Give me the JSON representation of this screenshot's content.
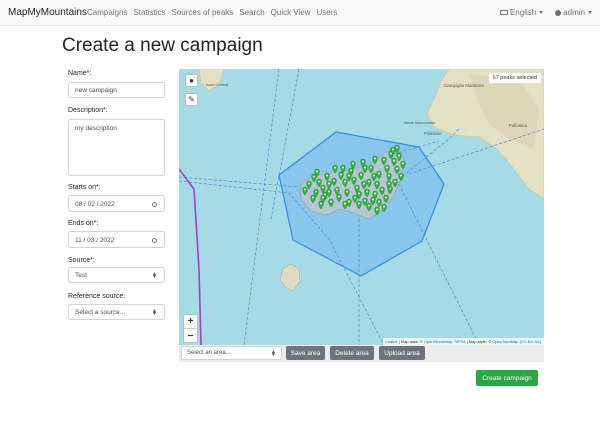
{
  "navbar": {
    "brand": "MapMyMountains",
    "links": [
      "Campaigns",
      "Statistics",
      "Sources of peaks",
      "Search",
      "Quick View",
      "Users"
    ],
    "language": "English",
    "user": "admin"
  },
  "page": {
    "title": "Create a new campaign"
  },
  "form": {
    "name": {
      "label": "Name*:",
      "value": "new campaign"
    },
    "description": {
      "label": "Description*:",
      "value": "my description"
    },
    "starts_on": {
      "label": "Starts on*:",
      "value": "08 / 02 / 2022"
    },
    "ends_on": {
      "label": "Ends on*:",
      "value": "11 / 03 / 2022"
    },
    "source": {
      "label": "Source*:",
      "value": "Test"
    },
    "reference_source": {
      "label": "Reference source:",
      "placeholder": "Select a source..."
    }
  },
  "map": {
    "peaks_selected": "67 peaks selected",
    "zoom_in": "+",
    "zoom_out": "−",
    "attribution": {
      "leaflet": "Leaflet",
      "map_data": "| Map data: © ",
      "osm": "OpenStreetMap",
      "srtm": "SRTM",
      "map_style": "| Map style: © ",
      "otm": "OpenTopoMap",
      "license": "(CC-BY-SA)"
    },
    "place_labels": [
      "Isola Cerboli",
      "Campiglia Marittima",
      "Monte Massoncello",
      "Piombino",
      "Follonica"
    ],
    "colors": {
      "sea": "#a6dbe6",
      "land": "#e6e0c8",
      "polygon": "#3388ff",
      "marker": "#2db53c"
    }
  },
  "toolbar": {
    "area_placeholder": "Select an area...",
    "save": "Save area",
    "delete": "Delete area",
    "upload": "Upload area"
  },
  "actions": {
    "create": "Create campaign"
  }
}
